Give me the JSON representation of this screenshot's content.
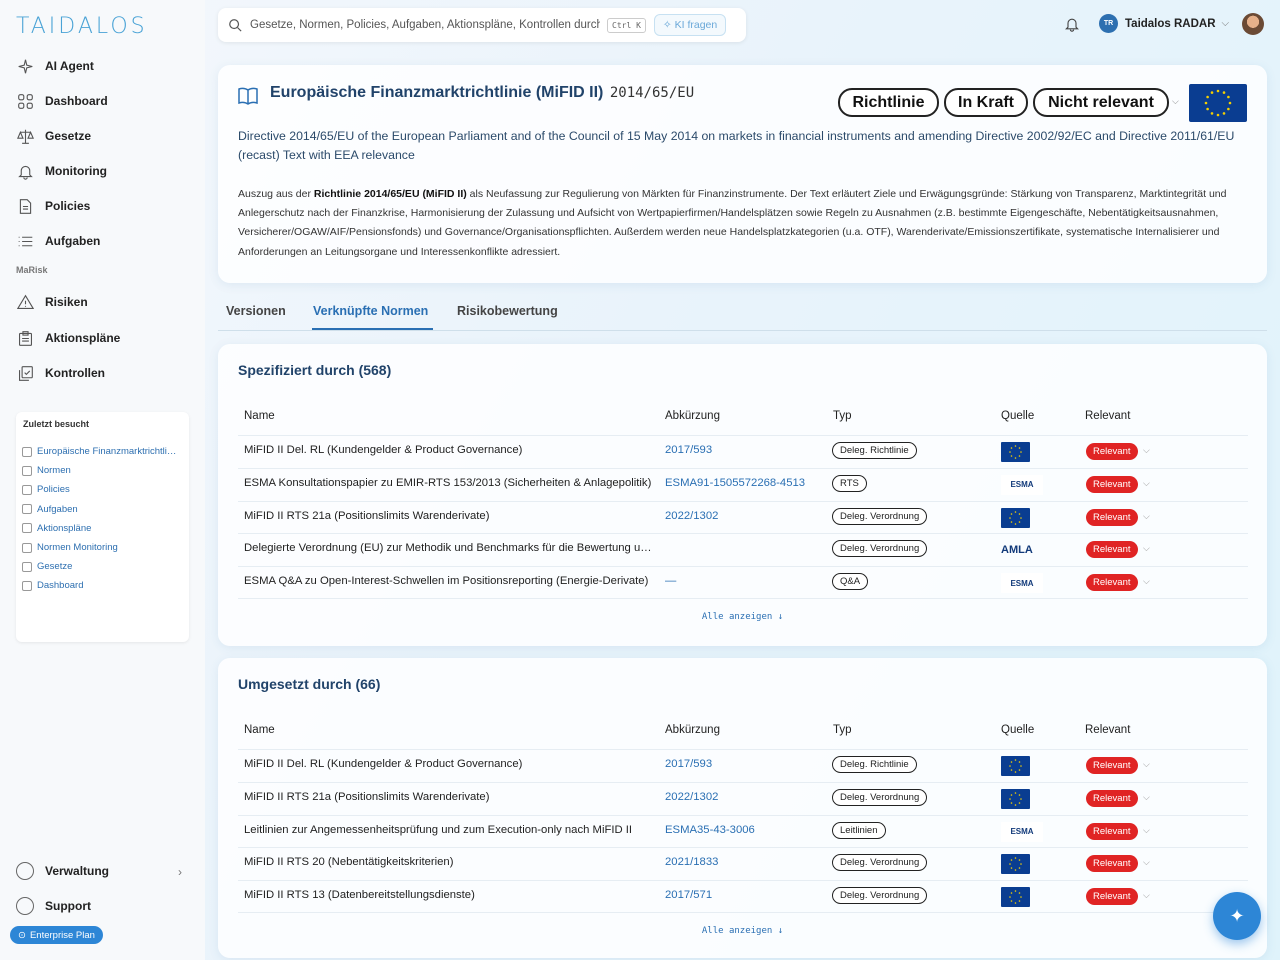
{
  "brand": {
    "name": "TAIDALOS"
  },
  "sidebar": {
    "items": [
      {
        "label": "AI Agent",
        "icon": "sparkle-icon"
      },
      {
        "label": "Dashboard",
        "icon": "grid-icon"
      },
      {
        "label": "Gesetze",
        "icon": "scales-icon"
      },
      {
        "label": "Monitoring",
        "icon": "bell-icon"
      },
      {
        "label": "Policies",
        "icon": "document-icon"
      },
      {
        "label": "Aufgaben",
        "icon": "list-icon"
      }
    ],
    "section_label": "MaRisk",
    "marisk_items": [
      {
        "label": "Risiken",
        "icon": "warning-icon"
      },
      {
        "label": "Aktionspläne",
        "icon": "clipboard-icon"
      },
      {
        "label": "Kontrollen",
        "icon": "copy-check-icon"
      }
    ],
    "recent": {
      "title": "Zuletzt besucht",
      "items": [
        "Europäische Finanzmarktrichtli…",
        "Normen",
        "Policies",
        "Aufgaben",
        "Aktionspläne",
        "Normen Monitoring",
        "Gesetze",
        "Dashboard"
      ]
    },
    "bottom": {
      "admin": "Verwaltung",
      "support": "Support"
    },
    "plan": "Enterprise Plan"
  },
  "topbar": {
    "search_placeholder": "Gesetze, Normen, Policies, Aufgaben, Aktionspläne, Kontrollen durchs",
    "shortcut": "Ctrl K",
    "ai_button": "KI fragen",
    "user": {
      "initials": "TR",
      "name": "Taidalos RADAR"
    }
  },
  "header": {
    "title": "Europäische Finanzmarktrichtlinie (MiFID II)",
    "code": "2014/65/EU",
    "tags": [
      "Richtlinie",
      "In Kraft",
      "Nicht relevant"
    ],
    "description": "Directive 2014/65/EU of the European Parliament and of the Council of 15 May 2014 on markets in financial instruments and amending Directive 2002/92/EC and Directive 2011/61/EU (recast) Text with EEA relevance",
    "excerpt_prefix": "Auszug aus der ",
    "excerpt_bold": "Richtlinie 2014/65/EU (MiFID II)",
    "excerpt_rest": " als Neufassung zur Regulierung von Märkten für Finanzinstrumente. Der Text erläutert Ziele und Erwägungsgründe: Stärkung von Transparenz, Marktintegrität und Anlegerschutz nach der Finanzkrise, Harmonisierung der Zulassung und Aufsicht von Wertpapierfirmen/Handelsplätzen sowie Regeln zu Ausnahmen (z.B. bestimmte Eigengeschäfte, Nebentätigkeitsausnahmen, Versicherer/OGAW/AIF/Pensionsfonds) und Governance/Organisationspflichten. Außerdem werden neue Handelsplatzkategorien (u.a. OTF), Warenderivate/Emissionszertifikate, systematische Internalisierer und Anforderungen an Leitungsorgane und Interessenkonflikte adressiert."
  },
  "tabs": [
    "Versionen",
    "Verknüpfte Normen",
    "Risikobewertung"
  ],
  "columns": [
    "Name",
    "Abkürzung",
    "Typ",
    "Quelle",
    "Relevant"
  ],
  "specified_by": {
    "title": "Spezifiziert durch (568)",
    "show_all": "Alle anzeigen ↓",
    "rows": [
      {
        "name": "MiFID II Del. RL (Kundengelder & Product Governance)",
        "abbr": "2017/593",
        "type": "Deleg. Richtlinie",
        "source": "eu-flag",
        "relevant": "Relevant"
      },
      {
        "name": "ESMA Konsultationspapier zu EMIR-RTS 153/2013 (Sicherheiten & Anlagepolitik)",
        "abbr": "ESMA91-1505572268-4513",
        "type": "RTS",
        "source": "ESMA",
        "relevant": "Relevant"
      },
      {
        "name": "MiFID II RTS 21a (Positionslimits Warenderivate)",
        "abbr": "2022/1302",
        "type": "Deleg. Verordnung",
        "source": "eu-flag",
        "relevant": "Relevant"
      },
      {
        "name": "Delegierte Verordnung (EU) zur Methodik und Benchmarks für die Bewertung u…",
        "abbr": "",
        "type": "Deleg. Verordnung",
        "source": "AMLA",
        "relevant": "Relevant"
      },
      {
        "name": "ESMA Q&A zu Open-Interest-Schwellen im Positionsreporting (Energie-Derivate)",
        "abbr": "—",
        "type": "Q&A",
        "source": "ESMA",
        "relevant": "Relevant"
      }
    ]
  },
  "implemented_by": {
    "title": "Umgesetzt durch (66)",
    "show_all": "Alle anzeigen ↓",
    "rows": [
      {
        "name": "MiFID II Del. RL (Kundengelder & Product Governance)",
        "abbr": "2017/593",
        "type": "Deleg. Richtlinie",
        "source": "eu-flag",
        "relevant": "Relevant"
      },
      {
        "name": "MiFID II RTS 21a (Positionslimits Warenderivate)",
        "abbr": "2022/1302",
        "type": "Deleg. Verordnung",
        "source": "eu-flag",
        "relevant": "Relevant"
      },
      {
        "name": "Leitlinien zur Angemessenheitsprüfung und zum Execution-only nach MiFID II",
        "abbr": "ESMA35-43-3006",
        "type": "Leitlinien",
        "source": "ESMA",
        "relevant": "Relevant"
      },
      {
        "name": "MiFID II RTS 20 (Nebentätigkeitskriterien)",
        "abbr": "2021/1833",
        "type": "Deleg. Verordnung",
        "source": "eu-flag",
        "relevant": "Relevant"
      },
      {
        "name": "MiFID II RTS 13 (Datenbereitstellungsdienste)",
        "abbr": "2017/571",
        "type": "Deleg. Verordnung",
        "source": "eu-flag",
        "relevant": "Relevant"
      }
    ]
  },
  "colors": {
    "accent": "#2a6fb3",
    "relevant": "#e02424",
    "eu_blue": "#0a3d91"
  }
}
